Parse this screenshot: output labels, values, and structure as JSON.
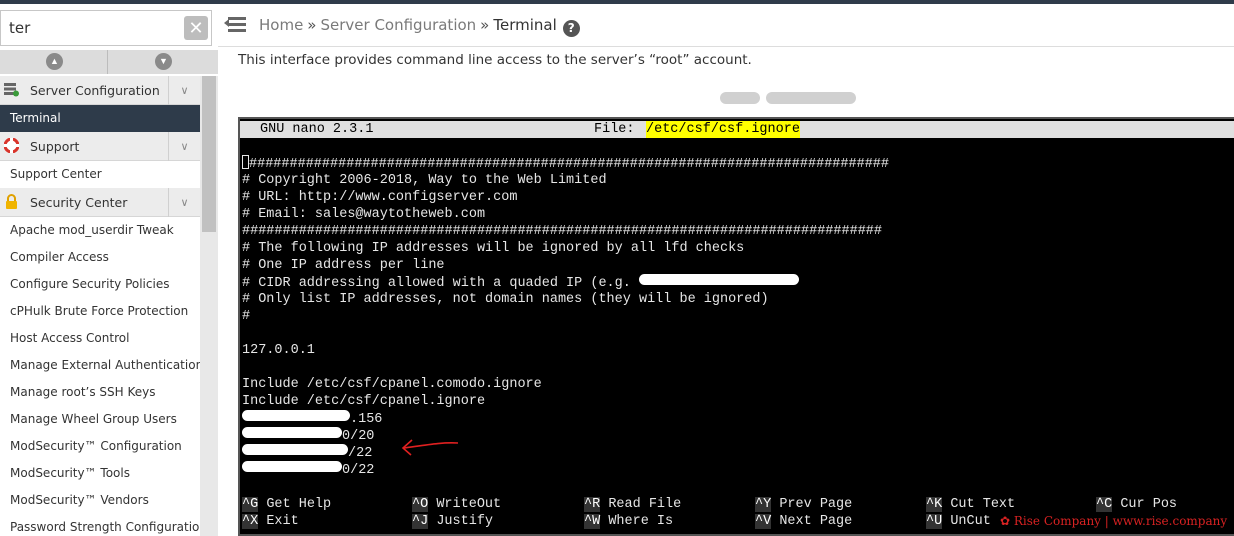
{
  "sidebar": {
    "search": {
      "value": "ter",
      "clear_icon": "clear-icon"
    },
    "scroll_up_icon": "chevron-up-icon",
    "scroll_down_icon": "chevron-down-icon",
    "groups": [
      {
        "label": "Server Configuration",
        "icon": "server-config-icon",
        "items": [
          "Terminal"
        ]
      },
      {
        "label": "Support",
        "icon": "lifebuoy-icon",
        "items": [
          "Support Center"
        ]
      },
      {
        "label": "Security Center",
        "icon": "lock-icon",
        "items": [
          "Apache mod_userdir Tweak",
          "Compiler Access",
          "Configure Security Policies",
          "cPHulk Brute Force Protection",
          "Host Access Control",
          "Manage External Authentications",
          "Manage root’s SSH Keys",
          "Manage Wheel Group Users",
          "ModSecurity™ Configuration",
          "ModSecurity™ Tools",
          "ModSecurity™ Vendors",
          "Password Strength Configuration"
        ]
      }
    ],
    "active_item": "Terminal"
  },
  "header": {
    "menu_icon": "menu-collapse-icon",
    "breadcrumb": [
      "Home",
      "Server Configuration",
      "Terminal"
    ],
    "separator": "»",
    "help_icon": "help-icon"
  },
  "main": {
    "description": "This interface provides command line access to the server’s “root” account."
  },
  "terminal": {
    "app_name": "GNU nano 2.3.1",
    "file_label": "File:",
    "file_path": "/etc/csf/csf.ignore",
    "lines": [
      "###############################################################################",
      "# Copyright 2006-2018, Way to the Web Limited",
      "# URL: http://www.configserver.com",
      "# Email: sales@waytotheweb.com",
      "###############################################################################",
      "# The following IP addresses will be ignored by all lfd checks",
      "# One IP address per line",
      "# CIDR addressing allowed with a quaded IP (e.g. ",
      "# Only list IP addresses, not domain names (they will be ignored)",
      "#",
      "",
      "127.0.0.1",
      "",
      "Include /etc/csf/cpanel.comodo.ignore",
      "Include /etc/csf/cpanel.ignore"
    ],
    "redacted_lines": [
      ".156",
      "0/20",
      "/22",
      "0/22"
    ],
    "shortcuts": [
      {
        "key": "^G",
        "label": "Get Help"
      },
      {
        "key": "^O",
        "label": "WriteOut"
      },
      {
        "key": "^R",
        "label": "Read File"
      },
      {
        "key": "^Y",
        "label": "Prev Page"
      },
      {
        "key": "^K",
        "label": "Cut Text"
      },
      {
        "key": "^C",
        "label": "Cur Pos"
      },
      {
        "key": "^X",
        "label": "Exit"
      },
      {
        "key": "^J",
        "label": "Justify"
      },
      {
        "key": "^W",
        "label": "Where Is"
      },
      {
        "key": "^V",
        "label": "Next Page"
      },
      {
        "key": "^U",
        "label": "UnCut"
      }
    ]
  },
  "watermark": {
    "text": "Rise Company | www.rise.company"
  },
  "colors": {
    "sidebar_active": "#2e3b4a",
    "annotation_arrow": "#e02020",
    "file_highlight": "#ffff00",
    "terminal_bg": "#000000"
  }
}
